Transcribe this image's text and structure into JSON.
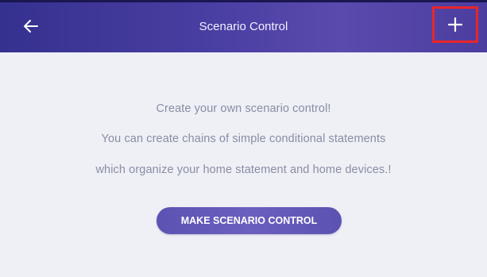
{
  "header": {
    "title": "Scenario Control",
    "back_icon": "arrow-left-icon",
    "add_icon": "plus-icon",
    "gradient_start": "#35318f",
    "gradient_end": "#5a4aad",
    "highlight_color": "#e8262a"
  },
  "content": {
    "line1": "Create your own scenario control!",
    "line2": "You can create chains of simple conditional statements",
    "line3": "which organize your home statement and home devices.!",
    "make_button_label": "MAKE SCENARIO CONTROL",
    "text_color": "#8a8da3",
    "button_color": "#5b52b2"
  }
}
